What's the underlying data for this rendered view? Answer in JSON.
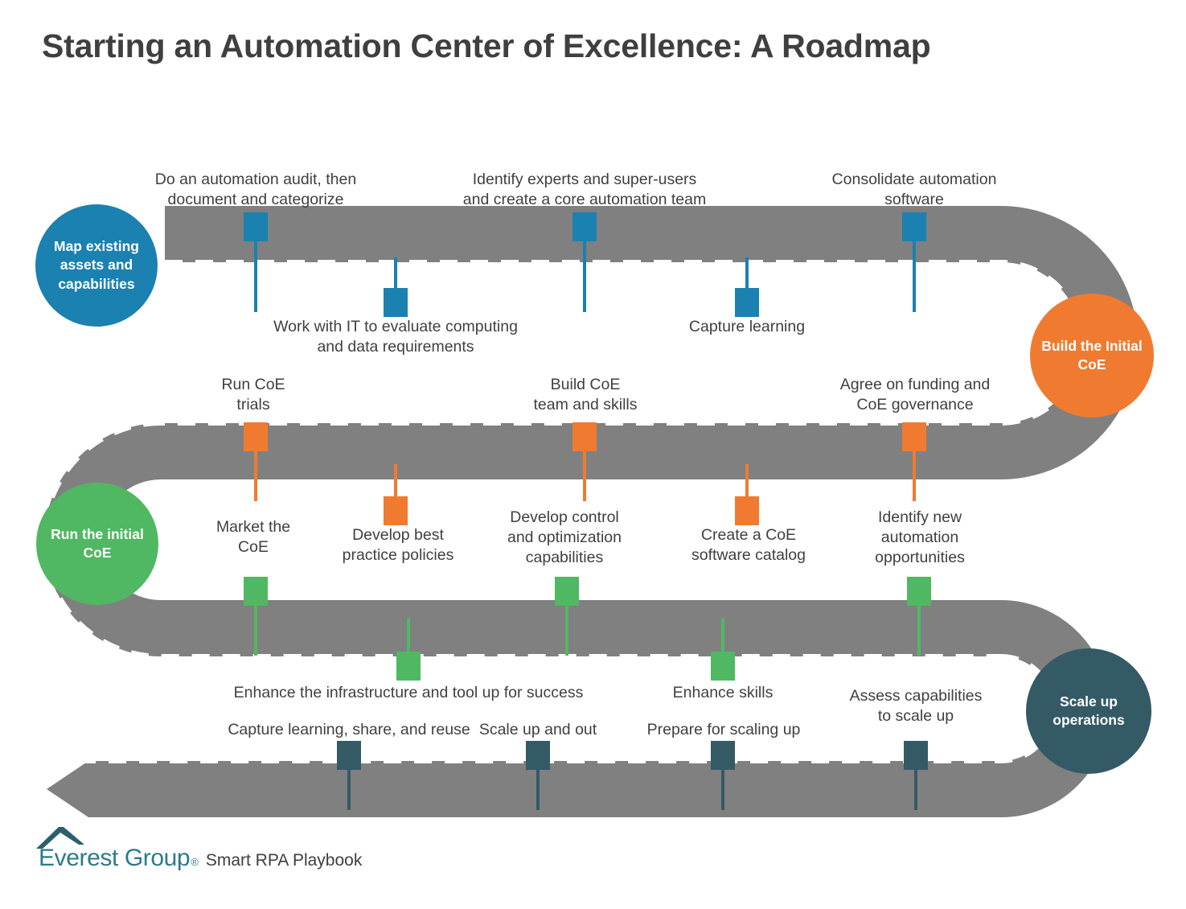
{
  "title": "Starting an Automation Center of Excellence: A Roadmap",
  "colors": {
    "blue": "#1b81b0",
    "orange": "#f07b30",
    "green": "#50b862",
    "teal": "#345a66",
    "road": "#808080",
    "road_dash": "#ffffff",
    "text": "#404040"
  },
  "stages": [
    {
      "id": "map-existing-assets",
      "label": "Map existing\nassets and\ncapabilities",
      "color": "#1b81b0"
    },
    {
      "id": "build-the-initial-coe",
      "label": "Build the\nInitial\nCoE",
      "color": "#f07b30"
    },
    {
      "id": "run-the-initial-coe",
      "label": "Run the\ninitial\nCoE",
      "color": "#50b862"
    },
    {
      "id": "scale-up-operations",
      "label": "Scale up\noperations",
      "color": "#345a66"
    }
  ],
  "milestones": [
    {
      "id": "automation-audit",
      "text": "Do an automation audit, then\ndocument and categorize",
      "color": "#1b81b0",
      "side": "above",
      "row": 1
    },
    {
      "id": "work-with-it",
      "text": "Work with IT to evaluate computing\nand data requirements",
      "color": "#1b81b0",
      "side": "below",
      "row": 1
    },
    {
      "id": "identify-experts",
      "text": "Identify experts and super-users\nand create a core automation team",
      "color": "#1b81b0",
      "side": "above",
      "row": 1
    },
    {
      "id": "capture-learning",
      "text": "Capture learning",
      "color": "#1b81b0",
      "side": "below",
      "row": 1
    },
    {
      "id": "consolidate-automation-software",
      "text": "Consolidate automation\nsoftware",
      "color": "#1b81b0",
      "side": "above",
      "row": 1
    },
    {
      "id": "run-coe-trials",
      "text": "Run CoE\ntrials",
      "color": "#f07b30",
      "side": "above",
      "row": 2
    },
    {
      "id": "develop-best-practice-policies",
      "text": "Develop best\npractice policies",
      "color": "#f07b30",
      "side": "below",
      "row": 2
    },
    {
      "id": "build-coe-team-and-skills",
      "text": "Build CoE\nteam and skills",
      "color": "#f07b30",
      "side": "above",
      "row": 2
    },
    {
      "id": "create-a-coe-software-catalog",
      "text": "Create a CoE\nsoftware catalog",
      "color": "#f07b30",
      "side": "below",
      "row": 2
    },
    {
      "id": "agree-on-funding",
      "text": "Agree on funding and\nCoE governance",
      "color": "#f07b30",
      "side": "above",
      "row": 2
    },
    {
      "id": "market-the-coe",
      "text": "Market the\nCoE",
      "color": "#50b862",
      "side": "above",
      "row": 3
    },
    {
      "id": "enhance-the-infrastructure",
      "text": "Enhance the infrastructure and tool up for success",
      "color": "#50b862",
      "side": "below",
      "row": 3
    },
    {
      "id": "develop-control-and-optimization",
      "text": "Develop control\nand optimization\ncapabilities",
      "color": "#50b862",
      "side": "above",
      "row": 3
    },
    {
      "id": "enhance-skills",
      "text": "Enhance skills",
      "color": "#50b862",
      "side": "below",
      "row": 3
    },
    {
      "id": "identify-new-automation-opportunities",
      "text": "Identify new\nautomation\nopportunities",
      "color": "#50b862",
      "side": "above",
      "row": 3
    },
    {
      "id": "capture-learning-share-and-reuse",
      "text": "Capture learning, share, and reuse",
      "color": "#345a66",
      "side": "above",
      "row": 4
    },
    {
      "id": "scale-up-and-out",
      "text": "Scale up and out",
      "color": "#345a66",
      "side": "above",
      "row": 4
    },
    {
      "id": "prepare-for-scaling-up",
      "text": "Prepare for scaling up",
      "color": "#345a66",
      "side": "above",
      "row": 4
    },
    {
      "id": "assess-capabilities-to-scale-up",
      "text": "Assess capabilities\nto scale up",
      "color": "#345a66",
      "side": "above",
      "row": 4
    }
  ],
  "footer": {
    "logo_text": "Everest Group",
    "logo_registered": "®",
    "tagline": "Smart RPA Playbook"
  }
}
